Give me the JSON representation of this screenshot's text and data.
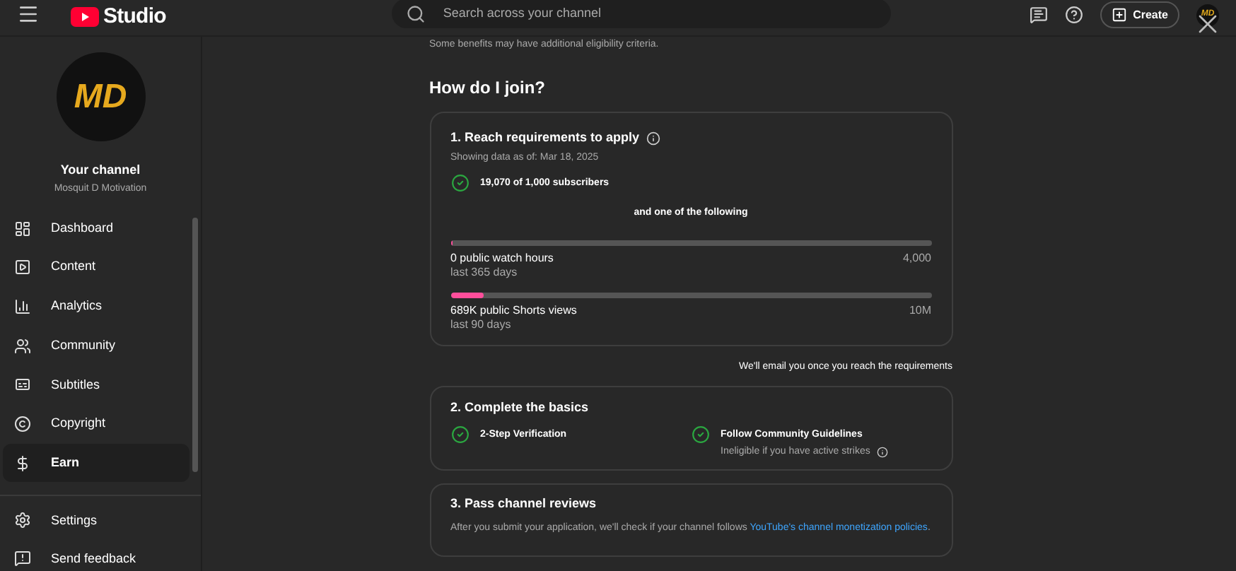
{
  "header": {
    "logo_text": "Studio",
    "search": {
      "placeholder": "Search across your channel"
    },
    "create_button": "Create",
    "avatar_text": "MD"
  },
  "sidebar": {
    "avatar_text": "MD",
    "title": "Your channel",
    "subtitle": "Mosquit D Motivation",
    "items": [
      {
        "label": "Dashboard",
        "selected": false
      },
      {
        "label": "Content",
        "selected": false
      },
      {
        "label": "Analytics",
        "selected": false
      },
      {
        "label": "Community",
        "selected": false
      },
      {
        "label": "Subtitles",
        "selected": false
      },
      {
        "label": "Copyright",
        "selected": false
      },
      {
        "label": "Earn",
        "selected": true
      }
    ],
    "footer_items": [
      {
        "label": "Settings"
      },
      {
        "label": "Send feedback"
      }
    ]
  },
  "main": {
    "note": "Some benefits may have additional eligibility criteria.",
    "heading": "How do I join?",
    "step1": {
      "title": "1. Reach requirements to apply",
      "date": "Showing data as of: Mar 18, 2025",
      "requirement": {
        "label": "19,070 of 1,000 subscribers",
        "checked": true
      },
      "separator": "and one of the following",
      "meters": [
        {
          "label": "0 public watch hours",
          "sublabel": "last 365 days",
          "target": "4,000",
          "level": 0
        },
        {
          "label": "689K public Shorts views",
          "sublabel": "last 90 days",
          "target": "10M",
          "level": 0.069
        }
      ]
    },
    "email_note": "We'll email you once you reach the requirements",
    "step2": {
      "title": "2. Complete the basics",
      "items": [
        {
          "label": "2-Step Verification",
          "checked": true
        },
        {
          "label": "Follow Community Guidelines",
          "detail": "Ineligible if you have active strikes",
          "checked": true
        }
      ]
    },
    "step3": {
      "title": "3. Pass channel reviews",
      "text": "After you submit your application, we'll check if your channel follows ",
      "link": "YouTube's channel monetization policies",
      "text_end": "."
    }
  }
}
